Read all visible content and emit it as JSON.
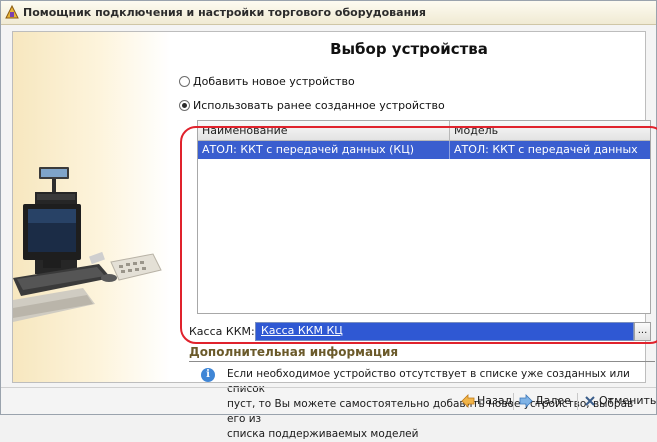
{
  "window": {
    "title": "Помощник подключения и настройки торгового оборудования"
  },
  "page": {
    "heading": "Выбор устройства"
  },
  "options": {
    "add_new": "Добавить новое устройство",
    "use_existing": "Использовать ранее созданное устройство",
    "selected": "use_existing"
  },
  "devices_table": {
    "columns": [
      "Наименование",
      "Модель"
    ],
    "rows": [
      {
        "name": "АТОЛ: ККТ с передачей данных (КЦ)",
        "model": "АТОЛ: ККТ с передачей данных"
      }
    ]
  },
  "kassa": {
    "label": "Касса ККМ:",
    "value": "Касса ККМ КЦ",
    "select_label": "..."
  },
  "additional_info": {
    "title": "Дополнительная информация",
    "lines": [
      "Если необходимое устройство отсутствует в списке уже созданных или список",
      "пуст, то Вы можете самостоятельно добавить новое устройство, выбрав его из",
      "списка поддерживаемых моделей"
    ]
  },
  "buttons": {
    "back": "Назад",
    "next": "Далее",
    "cancel": "Отменить"
  },
  "colors": {
    "selection": "#3a5ecf",
    "highlight_oval": "#e0222c",
    "info_title": "#6b5a2a"
  }
}
